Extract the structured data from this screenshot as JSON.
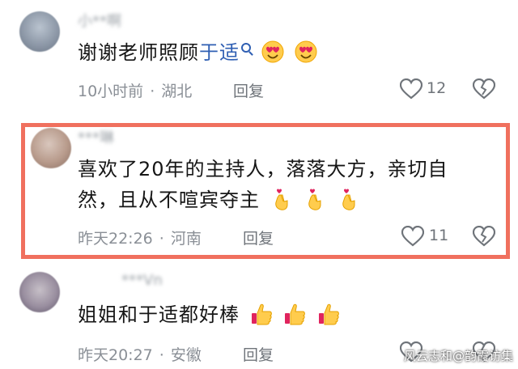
{
  "comments": [
    {
      "username": "小**啊",
      "text": "谢谢老师照顾",
      "link_text": "于适",
      "emoji": [
        "heart-eyes-emoji",
        "heart-eyes-emoji"
      ],
      "time": "10小时前",
      "location": "湖北",
      "reply_label": "回复",
      "likes": "12"
    },
    {
      "username": "***琳",
      "text_line1": "喜欢了20年的主持人，落落大方，亲切自",
      "text_line2": "然，且从不喧宾夺主",
      "emoji": [
        "finger-heart-emoji",
        "finger-heart-emoji",
        "finger-heart-emoji"
      ],
      "time": "昨天22:26",
      "location": "河南",
      "reply_label": "回复",
      "likes": "11"
    },
    {
      "username": "***Vn",
      "text": "姐姐和于适都好棒",
      "emoji": [
        "thumbs-up-emoji",
        "thumbs-up-emoji",
        "thumbs-up-emoji"
      ],
      "time": "昨天20:27",
      "location": "安徽",
      "reply_label": "回复"
    }
  ],
  "watermark": "风云志和@韵霞访集",
  "colors": {
    "highlight": "#f0705e",
    "link": "#2f5fb3",
    "meta": "#8a8f96"
  }
}
